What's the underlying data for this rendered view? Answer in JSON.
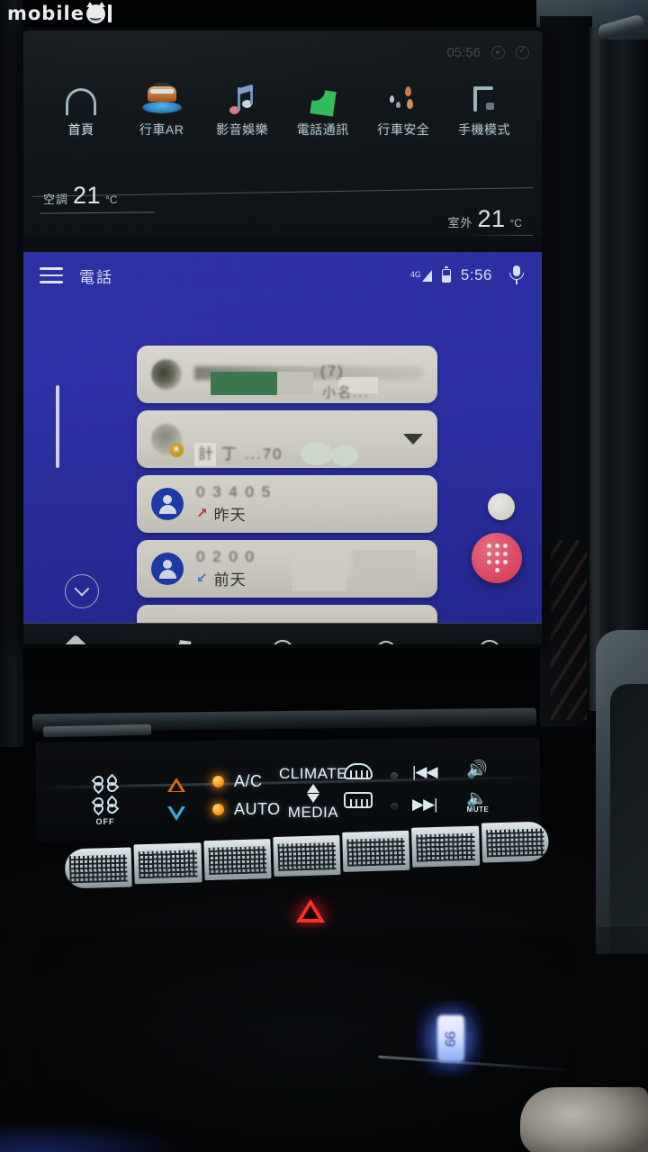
{
  "watermark": {
    "text": "mobile",
    "suffix": "1",
    "icon": "devil-face-icon"
  },
  "car_os": {
    "status": {
      "time": "05:56",
      "icons": [
        "gear-icon",
        "user-check-icon"
      ]
    },
    "apps": [
      {
        "label": "首頁",
        "icon": "home-icon"
      },
      {
        "label": "行車AR",
        "icon": "driving-ar-icon"
      },
      {
        "label": "影音娛樂",
        "icon": "music-note-icon"
      },
      {
        "label": "電話通訊",
        "icon": "phone-handset-icon"
      },
      {
        "label": "行車安全",
        "icon": "driving-safety-icon"
      },
      {
        "label": "手機模式",
        "icon": "phone-mode-icon"
      }
    ],
    "climate_readout": {
      "indoor_label": "空調",
      "indoor_value": "21",
      "indoor_unit": "°C",
      "outdoor_label": "室外",
      "outdoor_value": "21",
      "outdoor_unit": "°C"
    }
  },
  "android_auto": {
    "menu_icon": "hamburger-menu-icon",
    "title": "電話",
    "status": {
      "network": "4G",
      "signal_icon": "signal-bars-icon",
      "battery_icon": "battery-icon",
      "time": "5:56",
      "mic_icon": "microphone-icon"
    },
    "call_list": [
      {
        "avatar": "blurred-photo-avatar",
        "name_redacted": true,
        "primary": "(7)",
        "secondary": "小名...",
        "has_chevron": false
      },
      {
        "avatar": "blurred-photo-avatar",
        "badge": "star-badge",
        "name_redacted": true,
        "primary": "計 丁 ...70",
        "secondary": "",
        "has_chevron": true,
        "chevron_icon": "chevron-down-icon"
      },
      {
        "avatar": "person-avatar",
        "primary": "0  3  4 0  5",
        "call_type": "missed",
        "call_arrow_glyph": "↗",
        "time_label": "昨天",
        "has_chevron": false
      },
      {
        "avatar": "person-avatar",
        "primary": "0  2   0 0",
        "call_type": "incoming",
        "call_arrow_glyph": "↙",
        "time_label": "前天",
        "has_chevron": false
      }
    ],
    "fab_dial": {
      "icon": "dialpad-icon",
      "color": "#f4536f"
    },
    "fab_secondary": {
      "icon": "circle-button-icon",
      "color": "#eeede0"
    },
    "scroll_down_button": {
      "icon": "chevron-down-icon"
    },
    "nav_bar": [
      {
        "icon": "navigation-maps-icon",
        "name": "maps"
      },
      {
        "icon": "phone-icon",
        "name": "phone"
      },
      {
        "icon": "home-circle-icon",
        "name": "home"
      },
      {
        "icon": "headphones-media-icon",
        "name": "media"
      },
      {
        "icon": "recent-clock-icon",
        "name": "recents"
      }
    ]
  },
  "physical_controls": {
    "fan_up": {
      "icon": "fan-icon",
      "label": ""
    },
    "fan_off": {
      "icon": "fan-icon",
      "label": "OFF"
    },
    "temp_up": {
      "icon": "triangle-up-icon",
      "color": "#e2661a"
    },
    "temp_down": {
      "icon": "triangle-down-icon",
      "color": "#3ea5d6"
    },
    "ac": {
      "label": "A/C",
      "led": "on",
      "led_color": "#ff9b12"
    },
    "auto": {
      "label": "AUTO",
      "led": "on",
      "led_color": "#ff9b12"
    },
    "climate": {
      "label": "CLIMATE",
      "up_icon": "triangle-up-icon"
    },
    "media": {
      "label": "MEDIA",
      "down_icon": "triangle-down-icon"
    },
    "front_defrost": {
      "icon": "front-defrost-icon"
    },
    "rear_defrost": {
      "icon": "rear-defrost-icon"
    },
    "prev_track": {
      "icon": "previous-track-icon",
      "glyph": "|◀◀"
    },
    "next_track": {
      "icon": "next-track-icon",
      "glyph": "▶▶|"
    },
    "volume": {
      "icon": "volume-up-icon",
      "glyph": "🔊"
    },
    "mute": {
      "icon": "mute-icon",
      "label": "MUTE"
    }
  },
  "hazard_button": {
    "icon": "hazard-triangle-icon",
    "color": "#ff2d2d"
  },
  "console": {
    "blue_light": {
      "icon": "blue-led-glow",
      "color": "#8fb0ff"
    }
  }
}
